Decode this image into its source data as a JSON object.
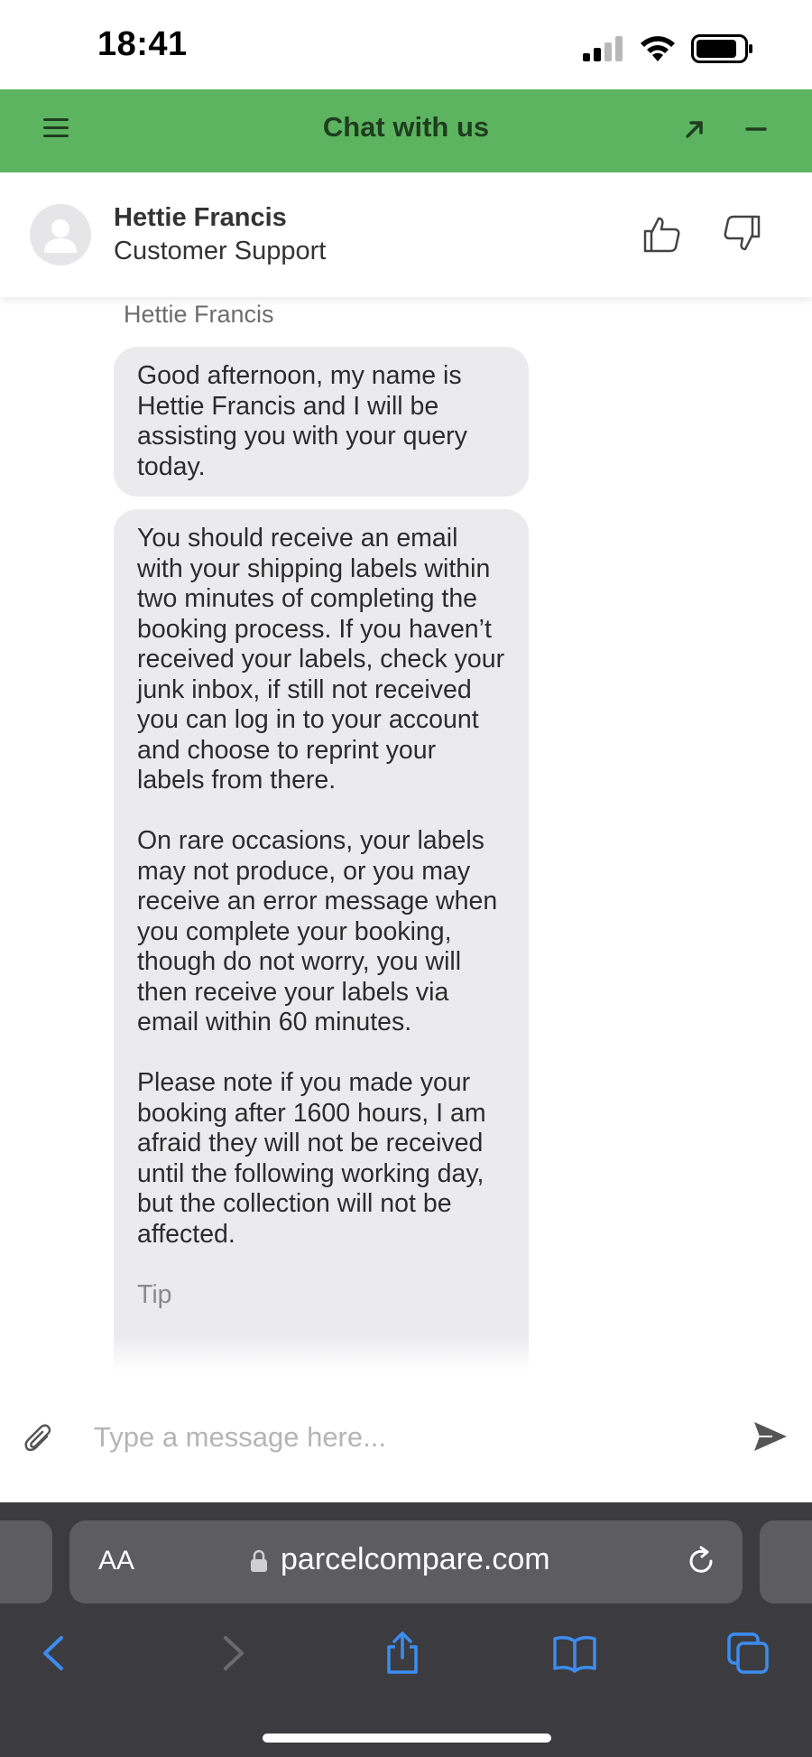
{
  "status_bar": {
    "time": "18:41"
  },
  "chat_header": {
    "title": "Chat with us",
    "icons": [
      "hamburger-menu-icon",
      "expand-arrow-icon",
      "minimize-icon"
    ],
    "color": "#5db460"
  },
  "agent": {
    "name": "Hettie Francis",
    "role": "Customer Support"
  },
  "conversation": {
    "sender_label": "Hettie Francis",
    "messages": [
      {
        "text": "Good afternoon, my name is Hettie Francis and I will be assisting you with your query today."
      },
      {
        "paragraphs": [
          "You should receive an email with your shipping labels within two minutes of completing the booking process. If you haven’t received your labels, check your junk inbox, if still not received you can log in to your account and choose to reprint your labels from there.",
          "On rare occasions, your labels may not produce, or you may receive an error message when you complete your booking, though do not worry, you will then receive your labels via email within 60 minutes.",
          "Please note if you made your booking after 1600 hours, I am afraid they will not be received until the following working day, but the collection will not be affected.",
          "Tip"
        ]
      }
    ]
  },
  "composer": {
    "placeholder": "Type a message here..."
  },
  "browser": {
    "text_size_label": "AA",
    "url": "parcelcompare.com"
  }
}
